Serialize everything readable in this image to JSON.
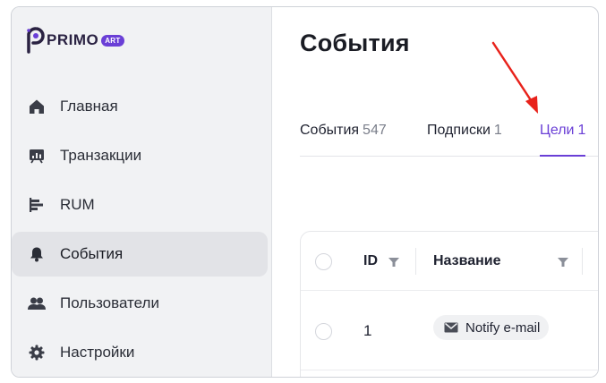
{
  "brand": {
    "name": "PRIMO",
    "badge": "ART"
  },
  "sidebar": {
    "items": [
      {
        "label": "Главная",
        "icon": "home-icon"
      },
      {
        "label": "Транзакции",
        "icon": "transactions-icon"
      },
      {
        "label": "RUM",
        "icon": "rum-bars-icon"
      },
      {
        "label": "События",
        "icon": "bell-icon",
        "active": true
      },
      {
        "label": "Пользователи",
        "icon": "users-icon"
      },
      {
        "label": "Настройки",
        "icon": "gear-icon"
      }
    ]
  },
  "page": {
    "title": "События"
  },
  "tabs": [
    {
      "label": "События",
      "count": "547"
    },
    {
      "label": "Подписки",
      "count": "1"
    },
    {
      "label": "Цели",
      "count": "1",
      "active": true
    }
  ],
  "table": {
    "headers": {
      "id": "ID",
      "name": "Название"
    },
    "rows": [
      {
        "id": "1",
        "name": "Notify e-mail",
        "icon": "mail-icon"
      }
    ]
  },
  "colors": {
    "accent": "#6a3fd6",
    "annotation_arrow": "#e8221b",
    "sidebar_bg": "#f1f2f4"
  }
}
